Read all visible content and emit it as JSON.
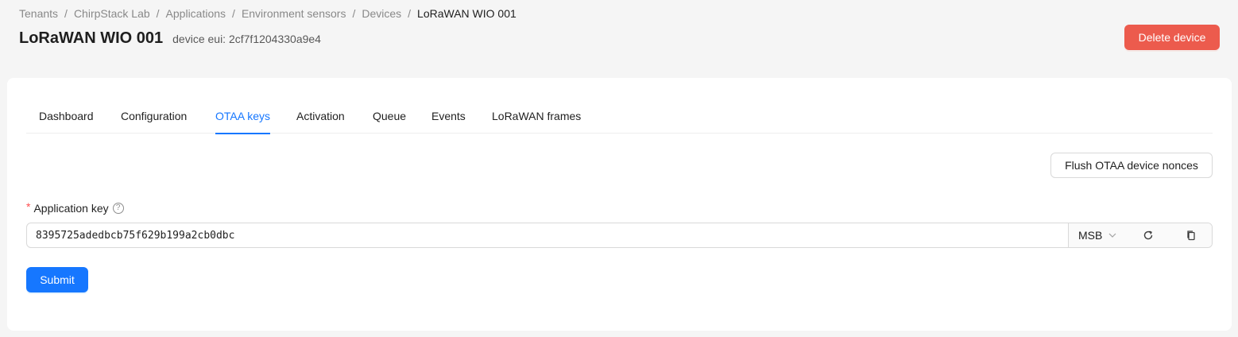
{
  "breadcrumb": {
    "items": [
      "Tenants",
      "ChirpStack Lab",
      "Applications",
      "Environment sensors",
      "Devices",
      "LoRaWAN WIO 001"
    ],
    "separator": "/"
  },
  "header": {
    "title": "LoRaWAN WIO 001",
    "subtitle": "device eui: 2cf7f1204330a9e4",
    "delete_label": "Delete device"
  },
  "tabs": [
    {
      "label": "Dashboard",
      "active": false
    },
    {
      "label": "Configuration",
      "active": false
    },
    {
      "label": "OTAA keys",
      "active": true
    },
    {
      "label": "Activation",
      "active": false
    },
    {
      "label": "Queue",
      "active": false
    },
    {
      "label": "Events",
      "active": false
    },
    {
      "label": "LoRaWAN frames",
      "active": false
    }
  ],
  "flush_label": "Flush OTAA device nonces",
  "form": {
    "app_key_label": "Application key",
    "required_mark": "*",
    "help_glyph": "?",
    "app_key_value": "8395725adedbcb75f629b199a2cb0dbc",
    "byte_order": "MSB",
    "submit_label": "Submit"
  },
  "colors": {
    "primary": "#1677ff",
    "danger": "#ec5b4d",
    "background": "#f5f5f5"
  },
  "icons": [
    "refresh-icon",
    "copy-icon",
    "chevron-down-icon",
    "question-circle-icon"
  ]
}
